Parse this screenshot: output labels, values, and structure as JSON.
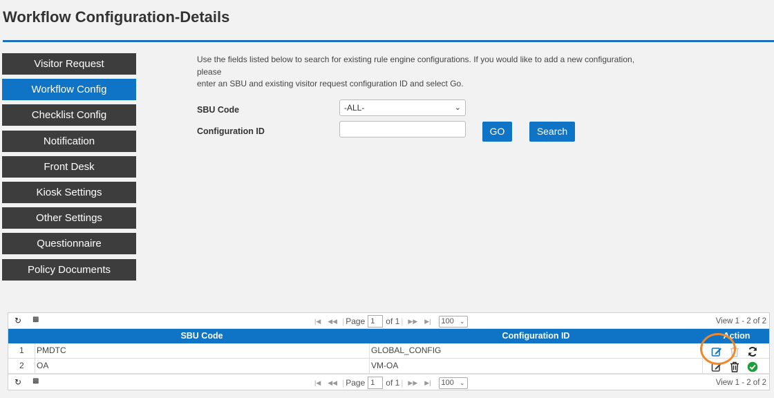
{
  "page": {
    "title": "Workflow Configuration-Details"
  },
  "sidebar": {
    "items": [
      {
        "label": "Visitor Request",
        "active": false
      },
      {
        "label": "Workflow Config",
        "active": true
      },
      {
        "label": "Checklist Config",
        "active": false
      },
      {
        "label": "Notification",
        "active": false
      },
      {
        "label": "Front Desk",
        "active": false
      },
      {
        "label": "Kiosk Settings",
        "active": false
      },
      {
        "label": "Other Settings",
        "active": false
      },
      {
        "label": "Questionnaire",
        "active": false
      },
      {
        "label": "Policy Documents",
        "active": false
      }
    ]
  },
  "intro": {
    "line1": "Use the fields listed below to search for existing rule engine configurations. If you would like to add a new configuration, please",
    "line2": "enter an SBU and existing visitor request configuration ID and select Go."
  },
  "form": {
    "sbu_label": "SBU Code",
    "sbu_value": "-ALL-",
    "config_label": "Configuration ID",
    "config_value": "",
    "go_label": "GO",
    "search_label": "Search"
  },
  "grid": {
    "pager": {
      "page_label": "Page",
      "page_value": "1",
      "of_label": "of 1",
      "rows_value": "100",
      "view_text": "View 1 - 2 of 2"
    },
    "headers": {
      "sbu": "SBU Code",
      "config": "Configuration ID",
      "action": "Action"
    },
    "rows": [
      {
        "num": "1",
        "sbu": "PMDTC",
        "config": "GLOBAL_CONFIG"
      },
      {
        "num": "2",
        "sbu": "OA",
        "config": "VM-OA"
      }
    ]
  },
  "colors": {
    "accent": "#0f73c6",
    "nav_dark": "#3d3d3d",
    "highlight": "#f0882a",
    "success": "#1e9e3a"
  },
  "icons": [
    "refresh-icon",
    "columns-icon",
    "first-page-icon",
    "prev-page-icon",
    "next-page-icon",
    "last-page-icon",
    "edit-icon",
    "delete-icon",
    "sync-icon",
    "check-circle-icon"
  ]
}
